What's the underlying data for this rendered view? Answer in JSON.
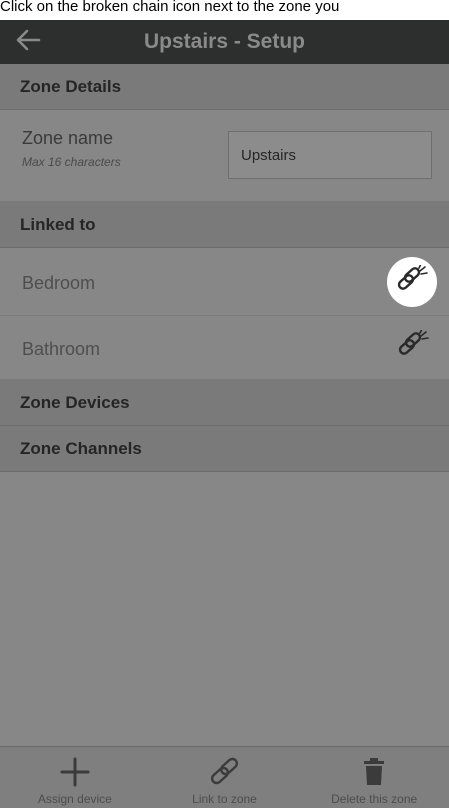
{
  "caption": "Click on the broken chain icon next to the zone you",
  "header": {
    "title": "Upstairs - Setup",
    "back_icon": "arrow-left-icon"
  },
  "zone_details": {
    "heading": "Zone Details",
    "name_label": "Zone name",
    "name_hint": "Max 16 characters",
    "name_value": "Upstairs"
  },
  "linked_to": {
    "heading": "Linked to",
    "items": [
      {
        "label": "Bedroom",
        "icon": "broken-chain-icon",
        "highlighted": true
      },
      {
        "label": "Bathroom",
        "icon": "broken-chain-icon",
        "highlighted": false
      }
    ]
  },
  "zone_devices": {
    "heading": "Zone Devices"
  },
  "zone_channels": {
    "heading": "Zone Channels"
  },
  "bottom_bar": {
    "items": [
      {
        "label": "Assign device",
        "icon": "plus-icon"
      },
      {
        "label": "Link to zone",
        "icon": "chain-link-icon"
      },
      {
        "label": "Delete this zone",
        "icon": "trash-icon"
      }
    ]
  },
  "colors": {
    "header_bg": "#2d2e2e",
    "screen_dim": "#878787",
    "section_bg": "#7a7a7a",
    "highlight": "#ffffff"
  }
}
